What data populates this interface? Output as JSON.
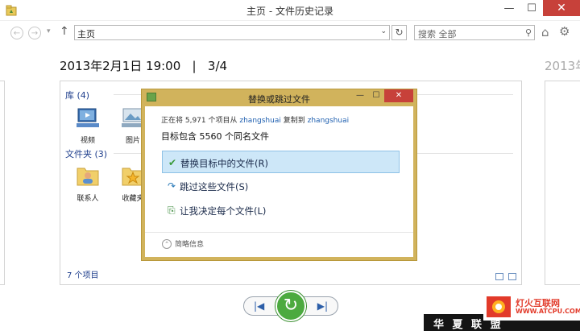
{
  "window": {
    "title": "主页 - 文件历史记录",
    "controls": {
      "minimize": "—",
      "maximize": "☐",
      "close": "✕"
    }
  },
  "toolbar": {
    "back": "←",
    "forward": "→",
    "recent": "▾",
    "up": "↑",
    "address": "主页",
    "address_drop": "⌄",
    "refresh": "↻",
    "search_placeholder": "搜索 全部",
    "search_glyph": "⚲",
    "home_glyph": "⌂",
    "gear_glyph": "⚙"
  },
  "history": {
    "current_label": "2013年2月1日 19:00   |   3/4",
    "next_label": "2013年"
  },
  "snapshot": {
    "groups": [
      {
        "label": "库 (4)"
      },
      {
        "label": "文件夹 (3)"
      }
    ],
    "library_items": [
      {
        "label": "视频",
        "icon": "video-library-icon"
      },
      {
        "label": "图片",
        "icon": "picture-library-icon"
      }
    ],
    "folder_items": [
      {
        "label": "联系人",
        "icon": "contacts-folder-icon"
      },
      {
        "label": "收藏夹",
        "icon": "favorites-folder-icon"
      }
    ],
    "status_count": "7 个项目"
  },
  "dialog": {
    "title": "替换或跳过文件",
    "copy_prefix": "正在将 5,971 个项目从",
    "copy_source": "zhangshuai",
    "copy_mid": "复制到",
    "copy_dest": "zhangshuai",
    "target_line": "目标包含 5560 个同名文件",
    "options": [
      {
        "label": "替换目标中的文件(R)",
        "glyph": "✔",
        "selected": true
      },
      {
        "label": "跳过这些文件(S)",
        "glyph": "↷",
        "selected": false
      },
      {
        "label": "让我决定每个文件(L)",
        "glyph": "⎘",
        "selected": false
      }
    ],
    "details_label": "简略信息",
    "details_glyph": "⌃",
    "controls": {
      "minimize": "—",
      "maximize": "☐",
      "close": "✕"
    }
  },
  "playback": {
    "prev_glyph": "|◀",
    "restore_glyph": "↻",
    "next_glyph": "▶|"
  },
  "watermark": {
    "bar_text": "华 夏 联 盟",
    "site_name": "灯火互联网",
    "site_url": "WWW.ATCPU.COM"
  },
  "colors": {
    "dialog_frame": "#d1b35c",
    "close_red": "#c7413a",
    "selection": "#cde7f8",
    "link_blue": "#2060b0",
    "restore_green": "#4caa3f"
  }
}
